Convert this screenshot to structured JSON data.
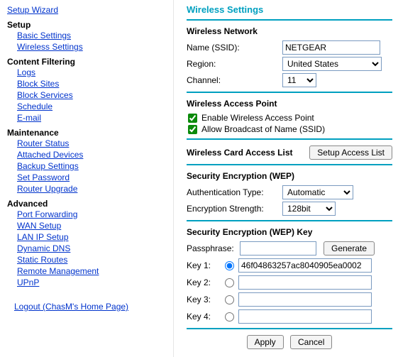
{
  "colors": {
    "accent": "#00a0c0",
    "link": "#0033cc"
  },
  "sidebar": {
    "setup_wizard": "Setup Wizard",
    "groups": {
      "setup": {
        "head": "Setup",
        "items": [
          "Basic Settings",
          "Wireless Settings"
        ]
      },
      "content_filtering": {
        "head": "Content Filtering",
        "items": [
          "Logs",
          "Block Sites",
          "Block Services",
          "Schedule",
          "E-mail"
        ]
      },
      "maintenance": {
        "head": "Maintenance",
        "items": [
          "Router Status",
          "Attached Devices",
          "Backup Settings",
          "Set Password",
          "Router Upgrade"
        ]
      },
      "advanced": {
        "head": "Advanced",
        "items": [
          "Port Forwarding",
          "WAN Setup",
          "LAN IP Setup",
          "Dynamic DNS",
          "Static Routes",
          "Remote Management",
          "UPnP"
        ]
      }
    },
    "logout": "Logout (ChasM's Home Page)"
  },
  "wireless": {
    "title": "Wireless Settings",
    "network_section": "Wireless Network",
    "name_label": "Name (SSID):",
    "name_value": "NETGEAR",
    "region_label": "Region:",
    "region_value": "United States",
    "channel_label": "Channel:",
    "channel_value": "11",
    "ap_section": "Wireless Access Point",
    "enable_ap": "Enable Wireless Access Point",
    "allow_broadcast": "Allow Broadcast of Name (SSID)",
    "access_list_section": "Wireless Card Access List",
    "setup_access_list_btn": "Setup Access List",
    "wep_section": "Security Encryption (WEP)",
    "auth_label": "Authentication Type:",
    "auth_value": "Automatic",
    "strength_label": "Encryption Strength:",
    "strength_value": "128bit",
    "wep_key_section": "Security Encryption (WEP) Key",
    "passphrase_label": "Passphrase:",
    "passphrase_value": "",
    "generate_btn": "Generate",
    "key1_label": "Key 1:",
    "key1_value": "46f04863257ac8040905ea0002",
    "key2_label": "Key 2:",
    "key2_value": "",
    "key3_label": "Key 3:",
    "key3_value": "",
    "key4_label": "Key 4:",
    "key4_value": "",
    "apply_btn": "Apply",
    "cancel_btn": "Cancel"
  }
}
